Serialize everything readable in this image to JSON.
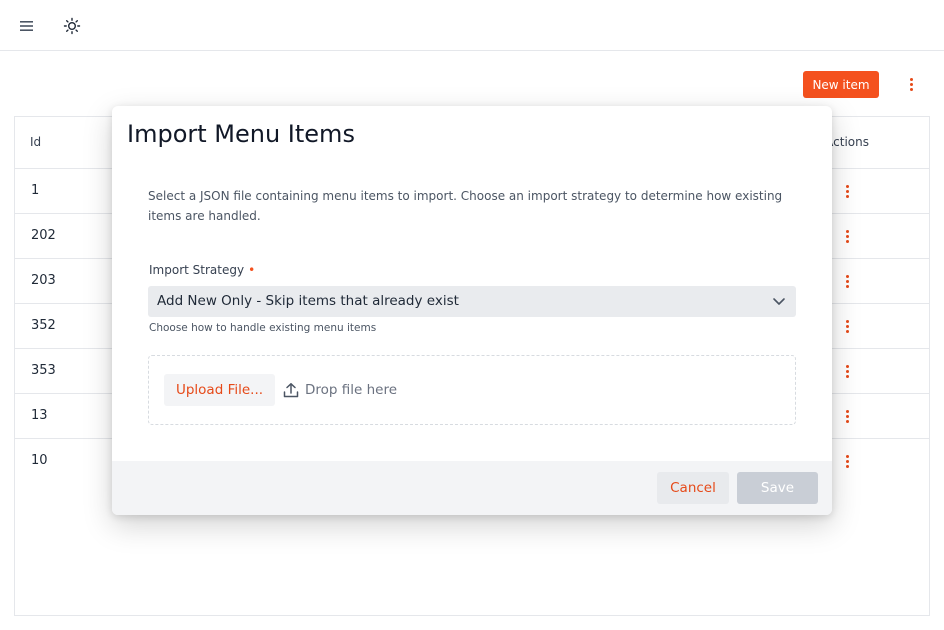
{
  "toolbar": {
    "new_item_label": "New item"
  },
  "table": {
    "headers": {
      "id": "Id",
      "actions": "Actions"
    },
    "rows": [
      {
        "id": "1"
      },
      {
        "id": "202"
      },
      {
        "id": "203"
      },
      {
        "id": "352"
      },
      {
        "id": "353"
      },
      {
        "id": "13"
      },
      {
        "id": "10"
      }
    ]
  },
  "modal": {
    "title": "Import Menu Items",
    "description": "Select a JSON file containing menu items to import. Choose an import strategy to determine how existing items are handled.",
    "strategy_label": "Import Strategy",
    "required_marker": "•",
    "strategy_value": "Add New Only - Skip items that already exist",
    "strategy_help": "Choose how to handle existing menu items",
    "upload_label": "Upload File...",
    "drop_hint": "Drop file here",
    "cancel_label": "Cancel",
    "save_label": "Save"
  },
  "colors": {
    "accent": "#f4511e",
    "accent_text": "#e64a19",
    "disabled": "#c9ced6"
  },
  "icons": {
    "menu": "hamburger-menu-icon",
    "theme": "sun-icon",
    "more": "more-vertical-icon",
    "chevron": "chevron-down-icon",
    "upload": "upload-icon"
  }
}
